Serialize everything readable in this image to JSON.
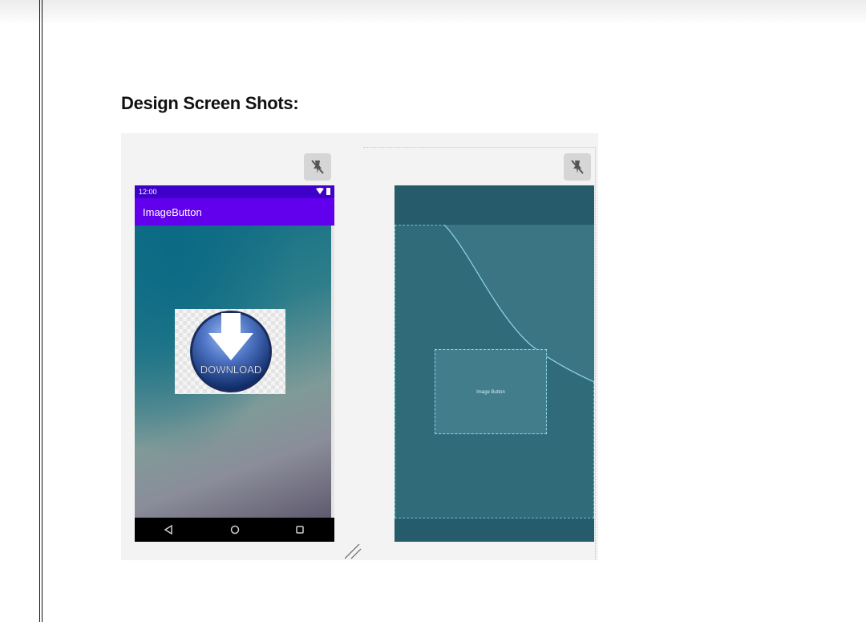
{
  "document": {
    "heading": "Design Screen Shots:"
  },
  "design_preview": {
    "status_time": "12:00",
    "app_title": "ImageButton",
    "image_button_text": "DOWNLOAD",
    "icons": {
      "pin": "pin-toggle-icon",
      "wifi": "wifi-icon",
      "battery": "battery-icon",
      "back": "nav-back-icon",
      "home": "nav-home-icon",
      "recents": "nav-recents-icon",
      "resize": "resize-handle-icon"
    },
    "colors": {
      "status_bar": "#3f00c9",
      "app_bar": "#6200ee",
      "nav_bar": "#000000"
    }
  },
  "blueprint_preview": {
    "image_button_label": "Image Button",
    "colors": {
      "background": "#306b7a",
      "outline": "#6fc0d3"
    }
  }
}
